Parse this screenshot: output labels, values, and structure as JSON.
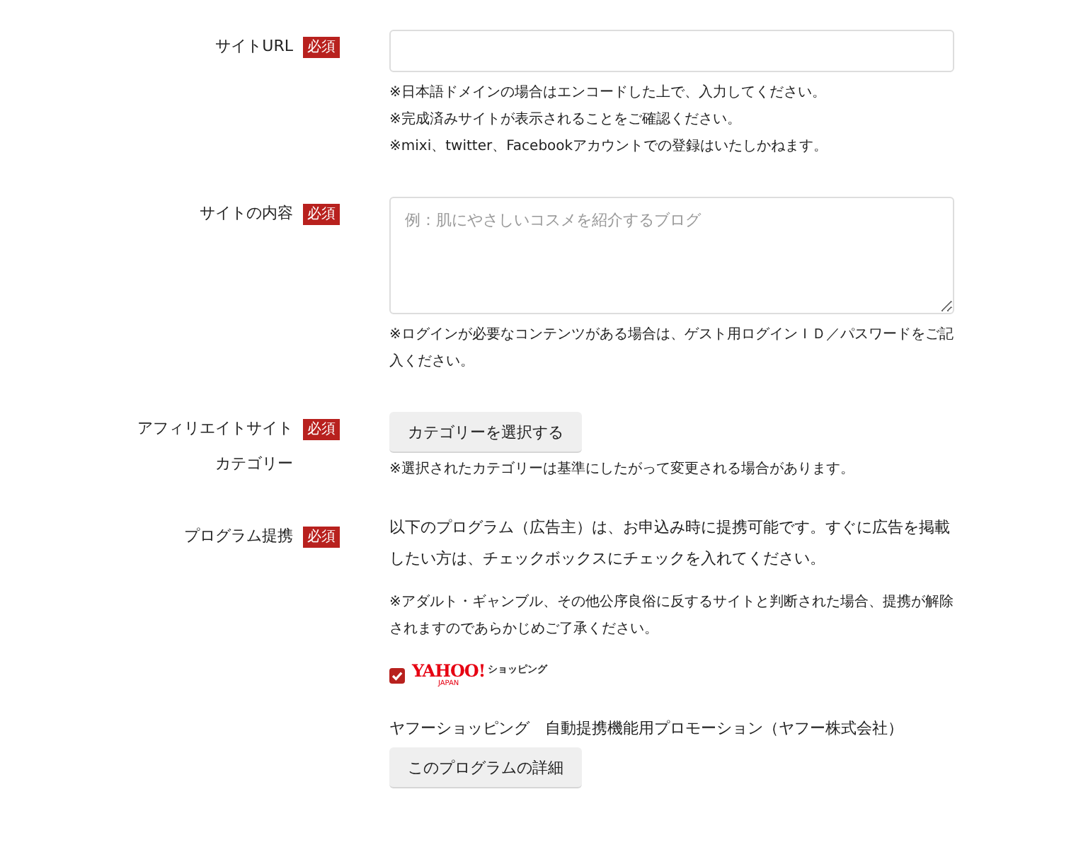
{
  "fields": [
    {
      "kind": "text-input",
      "label": [
        "サイトURL"
      ],
      "required": true,
      "badge": "必須",
      "notes": [
        "※日本語ドメインの場合はエンコードした上で、入力してください。",
        "※完成済みサイトが表示されることをご確認ください。",
        "※mixi、twitter、Facebookアカウントでの登録はいたしかねます。"
      ]
    },
    {
      "kind": "textarea",
      "label": [
        "サイトの内容"
      ],
      "required": true,
      "badge": "必須",
      "placeholder": "例：肌にやさしいコスメを紹介するブログ",
      "notes": [
        "※ログインが必要なコンテンツがある場合は、ゲスト用ログインＩＤ／パスワードをご記入ください。"
      ]
    },
    {
      "kind": "select-button",
      "label": [
        "アフィリエイトサイト",
        "カテゴリー"
      ],
      "required": true,
      "badge": "必須",
      "button": "カテゴリーを選択する",
      "notes": [
        "※選択されたカテゴリーは基準にしたがって変更される場合があります。"
      ]
    },
    {
      "kind": "program",
      "label": [
        "プログラム提携"
      ],
      "required": true,
      "badge": "必須",
      "intro": "以下のプログラム（広告主）は、お申込み時に提携可能です。すぐに広告を掲載したい方は、チェックボックスにチェックを入れてください。",
      "notes": [
        "※アダルト・ギャンブル、その他公序良俗に反するサイトと判断された場合、提携が解除されますのであらかじめご了承ください。"
      ],
      "programs": [
        {
          "checked": true,
          "logo": {
            "main": "YAHOO!",
            "sub": "JAPAN",
            "tag": "ショッピング"
          },
          "name": "ヤフーショッピング　自動提携機能用プロモーション（ヤフー株式会社）",
          "button": "このプログラムの詳細"
        }
      ]
    }
  ]
}
